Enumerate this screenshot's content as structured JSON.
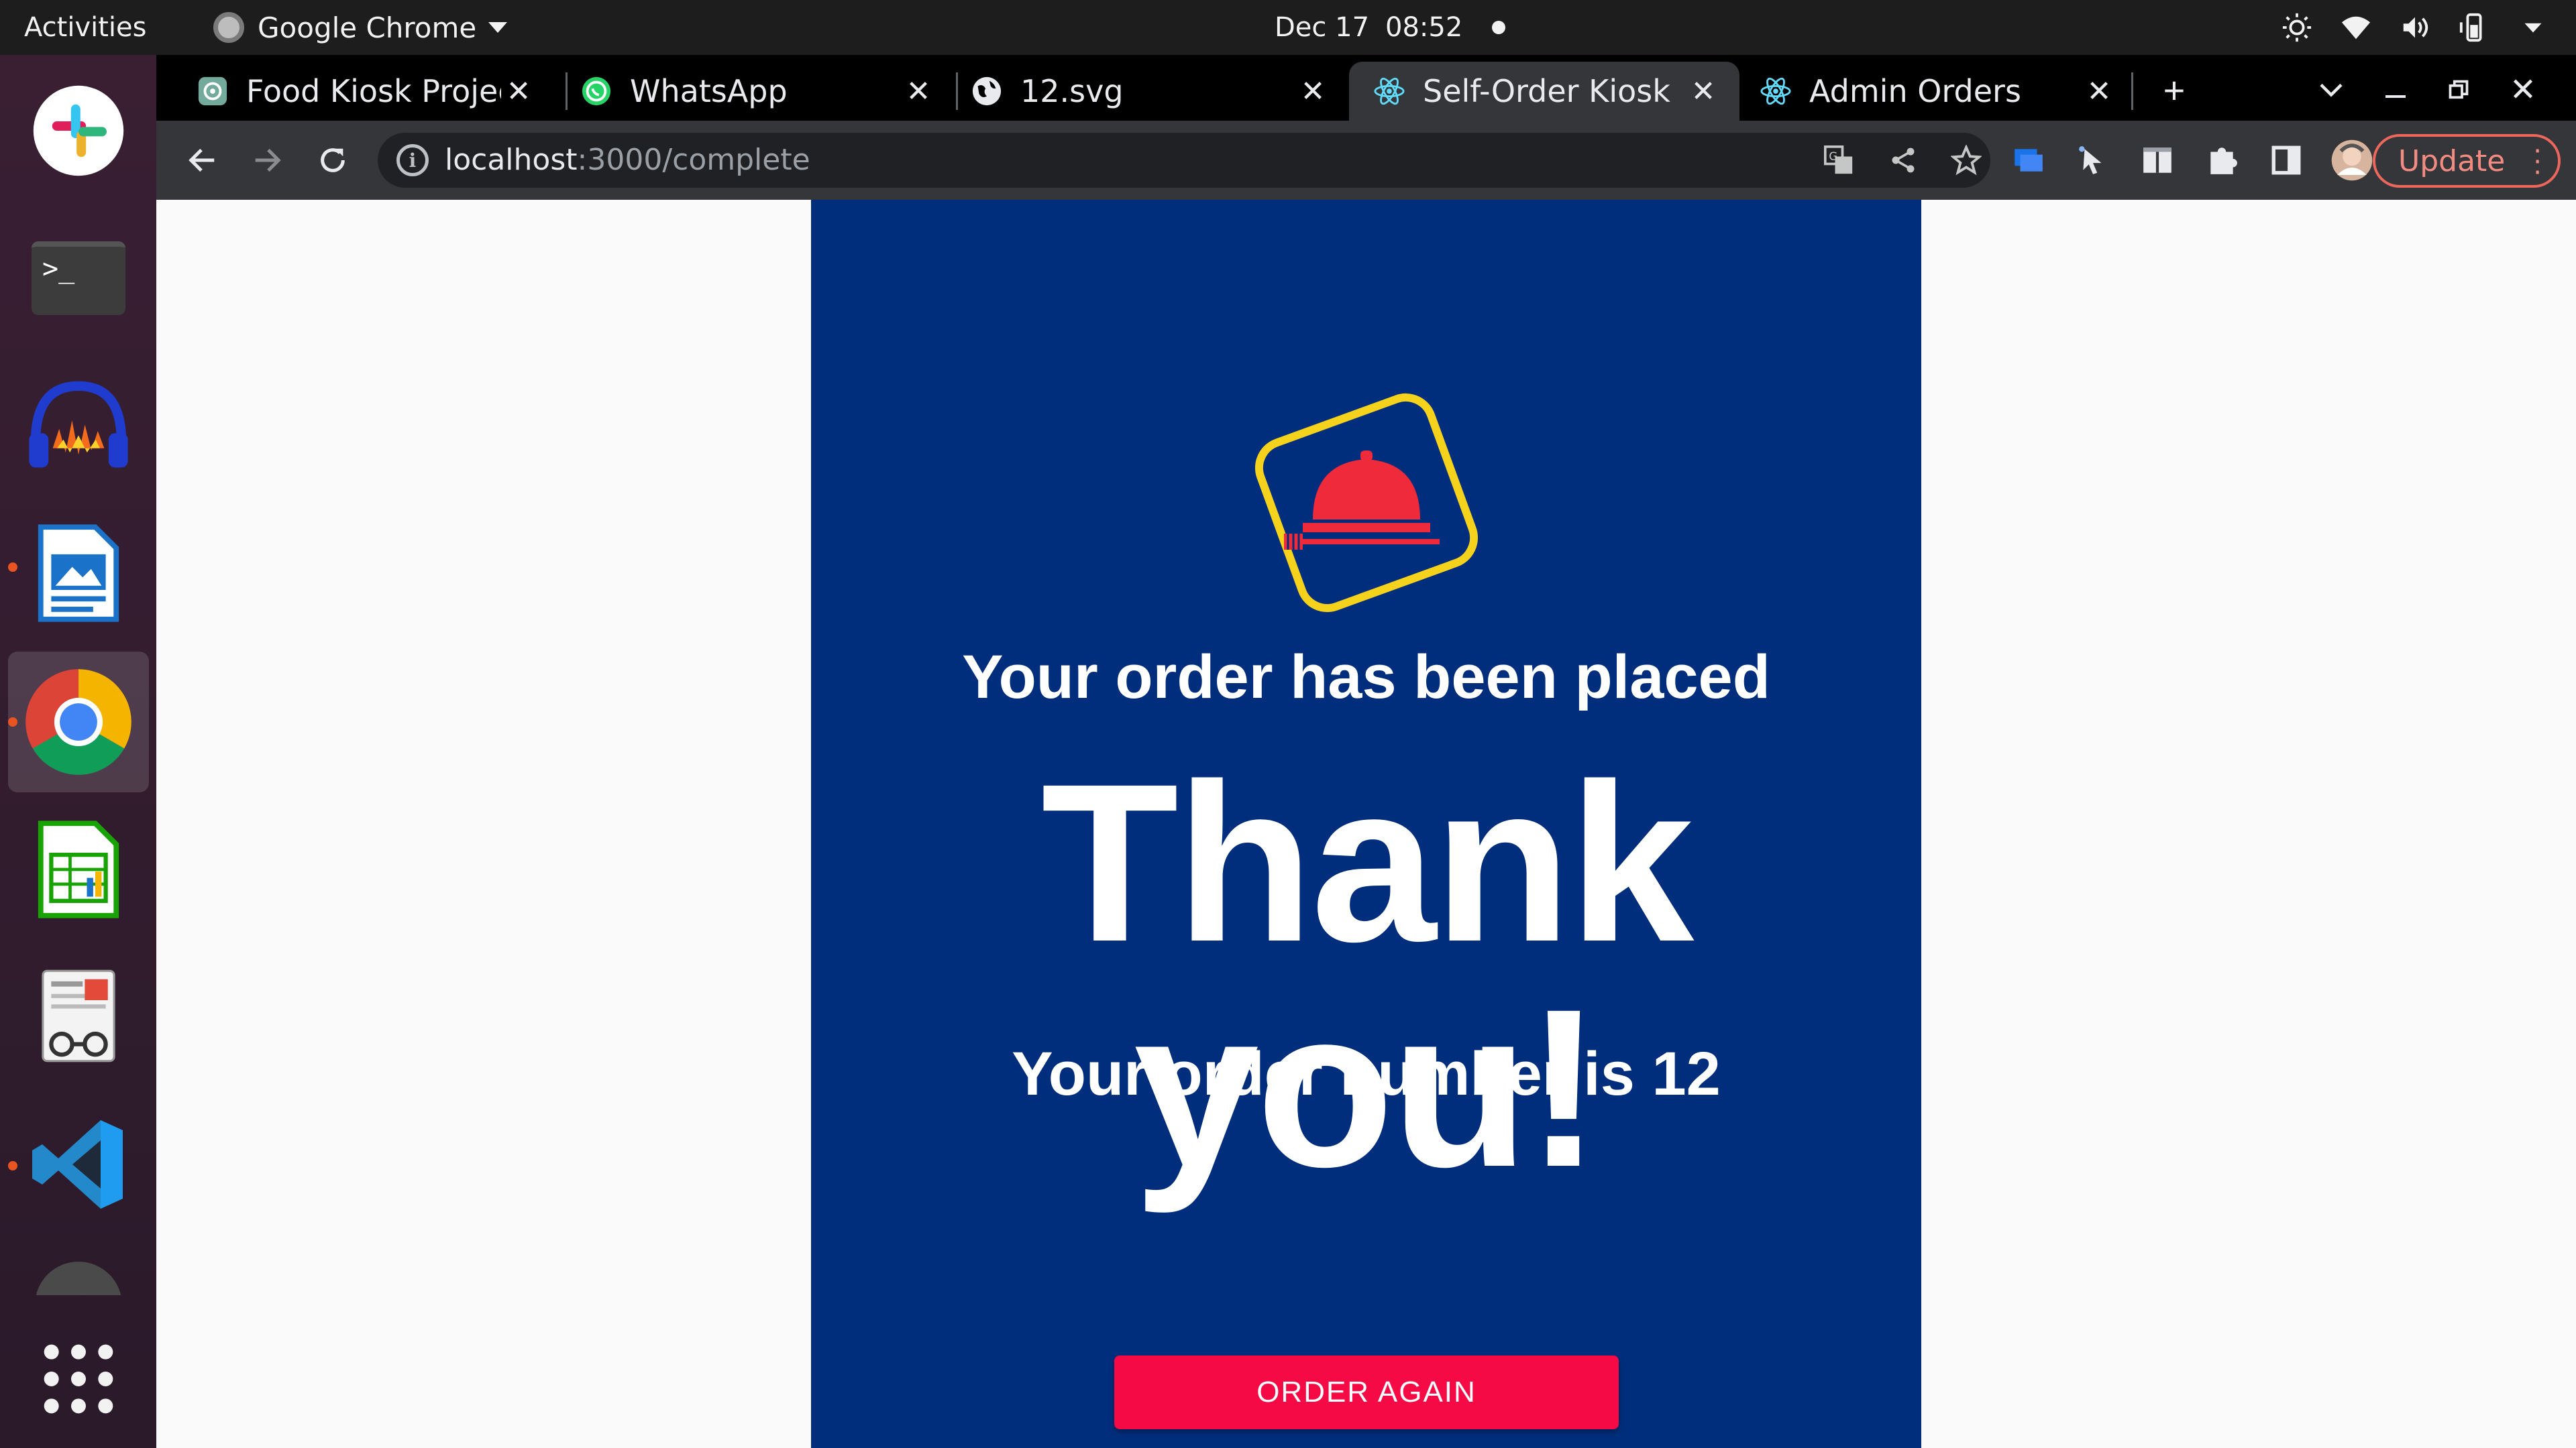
{
  "topbar": {
    "activities": "Activities",
    "app_name": "Google Chrome",
    "date": "Dec 17",
    "time": "08:52"
  },
  "dock": {
    "items": [
      "slack-icon",
      "terminal-icon",
      "audacity-icon",
      "libreoffice-impress-icon",
      "chrome-icon",
      "libreoffice-calc-icon",
      "document-viewer-icon",
      "vscode-icon",
      "show-applications-icon"
    ]
  },
  "tabs": [
    {
      "title": "Food Kiosk Project",
      "icon": "openai-icon"
    },
    {
      "title": "WhatsApp",
      "icon": "whatsapp-icon"
    },
    {
      "title": "12.svg",
      "icon": "globe-icon"
    },
    {
      "title": "Self-Order Kiosk",
      "icon": "react-icon",
      "active": true
    },
    {
      "title": "Admin Orders",
      "icon": "react-icon"
    }
  ],
  "address_bar": {
    "host": "localhost",
    "path": ":3000/complete"
  },
  "update_button": "Update",
  "colors": {
    "kiosk_background": "#002e7c",
    "accent_button": "#f50a45",
    "logo_frame": "#f5d31c",
    "logo_cloche": "#ee2a3b"
  },
  "kiosk": {
    "placed_message": "Your order has been placed",
    "thank_you": "Thank you!",
    "order_number_text": "Your order number is 12",
    "order_again_label": "ORDER AGAIN"
  }
}
